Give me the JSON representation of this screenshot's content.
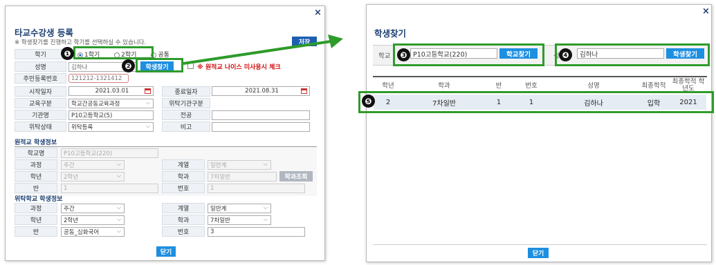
{
  "dialog1": {
    "title": "타교수강생 등록",
    "note": "※ 학생찾기를 진행하고 학기를 선택하실 수 있습니다.",
    "save_label": "저장",
    "close_label": "×",
    "labels": {
      "term": "학기",
      "name": "성명",
      "resident_no": "주민등록번호",
      "start_date": "시작일자",
      "end_date": "종료일자",
      "edu_type": "교육구분",
      "trust_type": "위탁기관구분",
      "institution": "기관명",
      "major": "전공",
      "trust_status": "위탁상태",
      "remark": "비고"
    },
    "term_options": [
      "1학기",
      "2학기",
      "공통"
    ],
    "term_selected": "1학기",
    "name_value": "김하나",
    "find_student_label": "학생찾기",
    "warning_text": "※ 원적교 나이스 미사용시 체크",
    "resident_no_value": "121212-1321412",
    "start_date_value": "2021.03.01",
    "end_date_value": "2021.08.31",
    "edu_type_value": "학교간공동교육과정",
    "institution_value": "P10고등학교(5)",
    "trust_status_value": "위탁등록",
    "origin_section": "원적교 학생정보",
    "origin": {
      "school_label": "학교명",
      "school_value": "P10고등학교(220)",
      "course_label": "과정",
      "course_value": "주간",
      "series_label": "계열",
      "series_value": "일반계",
      "grade_label": "학년",
      "grade_value": "2학년",
      "dept_label": "학과",
      "dept_value": "7차일반",
      "dept_search_label": "학과조회",
      "class_label": "반",
      "class_value": "1",
      "number_label": "번호",
      "number_value": "1"
    },
    "trust_section": "위탁학교 학생정보",
    "trust": {
      "course_label": "과정",
      "course_value": "주간",
      "series_label": "계열",
      "series_value": "일반계",
      "grade_label": "학년",
      "grade_value": "2학년",
      "dept_label": "학과",
      "dept_value": "7차일반",
      "class_label": "반",
      "class_value": "공동_심화국어",
      "number_label": "번호",
      "number_value": "3"
    },
    "close_button": "닫기"
  },
  "dialog2": {
    "title": "학생찾기",
    "close_label": "×",
    "school_label": "학교",
    "school_value": "P10고등학교(220)",
    "school_search_label": "학교찾기",
    "name_label": "성명",
    "name_value": "김하나",
    "student_search_label": "학생찾기",
    "columns": [
      "학년",
      "학과",
      "반",
      "번호",
      "성명",
      "최종학적",
      "최종학적 학년도"
    ],
    "rows": [
      [
        "2",
        "7차일반",
        "1",
        "1",
        "김하나",
        "입학",
        "2021"
      ]
    ],
    "close_button": "닫기"
  },
  "markers": [
    "❶",
    "❷",
    "❸",
    "❹",
    "❺"
  ],
  "colors": {
    "accent": "#1d8fe0",
    "highlight": "#2e9b2a",
    "title": "#1c3f72"
  }
}
